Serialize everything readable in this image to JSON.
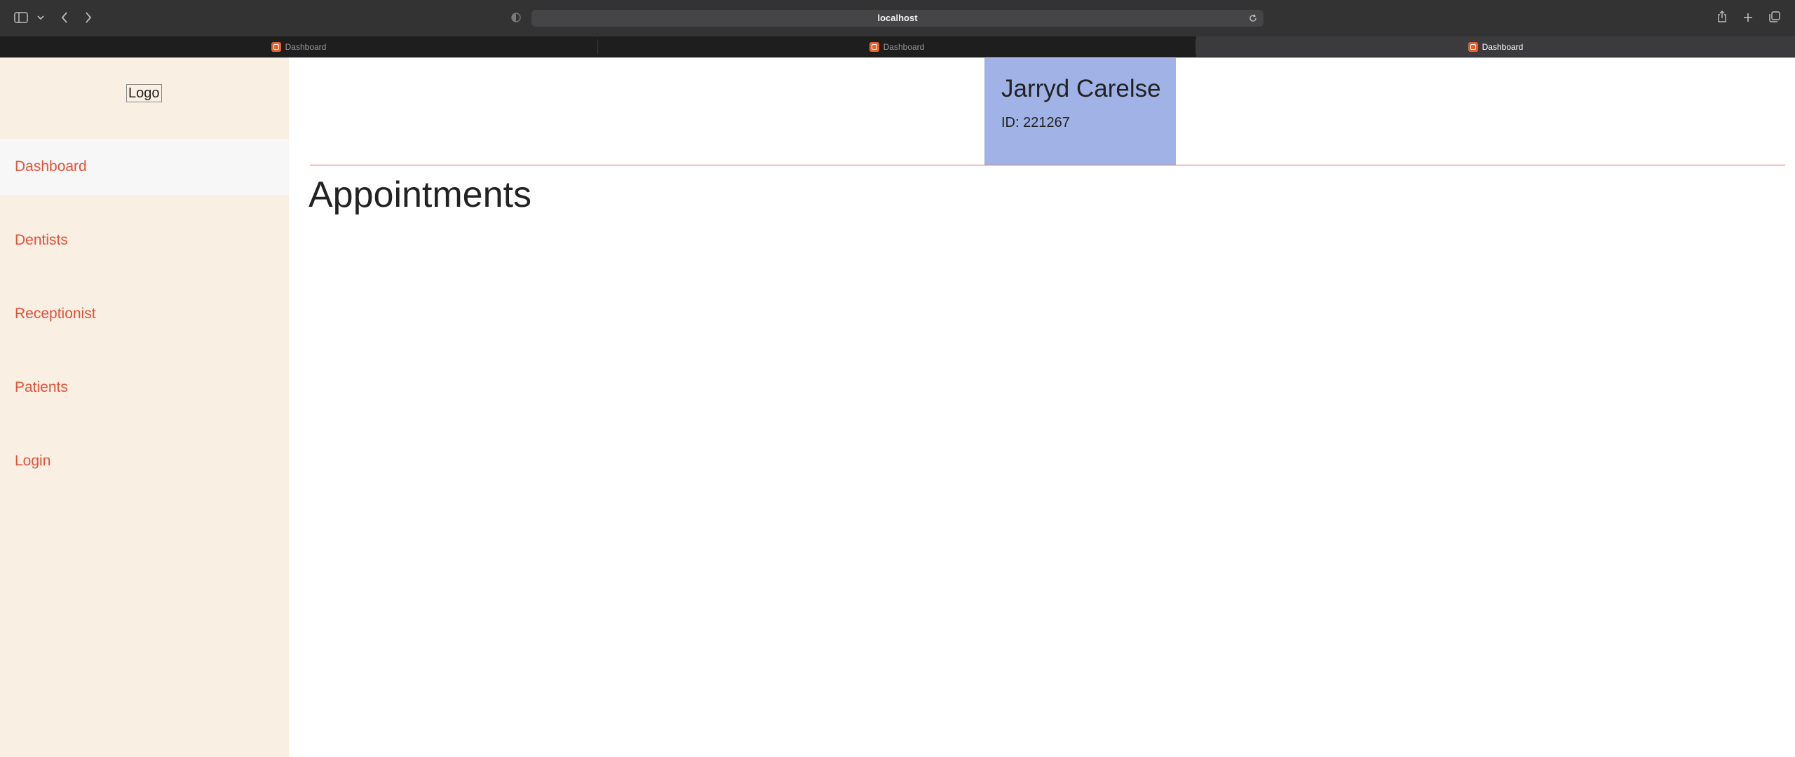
{
  "browser": {
    "url": "localhost",
    "tabs": [
      {
        "title": "Dashboard",
        "active": false
      },
      {
        "title": "Dashboard",
        "active": false
      },
      {
        "title": "Dashboard",
        "active": true
      }
    ],
    "icons": {
      "sidebar_toggle": "sidebar-icon",
      "sidebar_menu": "chevron-down-icon",
      "back": "chevron-left-icon",
      "forward": "chevron-right-icon",
      "privacy": "shield-icon",
      "reload": "reload-icon",
      "share": "share-icon",
      "new_tab": "plus-icon",
      "tab_overview": "tabs-icon"
    }
  },
  "sidebar": {
    "logo": "Logo",
    "items": [
      {
        "label": "Dashboard",
        "active": true
      },
      {
        "label": "Dentists",
        "active": false
      },
      {
        "label": "Receptionist",
        "active": false
      },
      {
        "label": "Patients",
        "active": false
      },
      {
        "label": "Login",
        "active": false
      }
    ]
  },
  "user": {
    "name": "Jarryd Carelse",
    "id_text": "ID: 221267"
  },
  "main": {
    "title": "Appointments"
  },
  "colors": {
    "sidebar_bg": "#f9efe3",
    "accent": "#e0533a",
    "user_card_bg": "#a1b3e6",
    "divider": "#e8604a"
  }
}
